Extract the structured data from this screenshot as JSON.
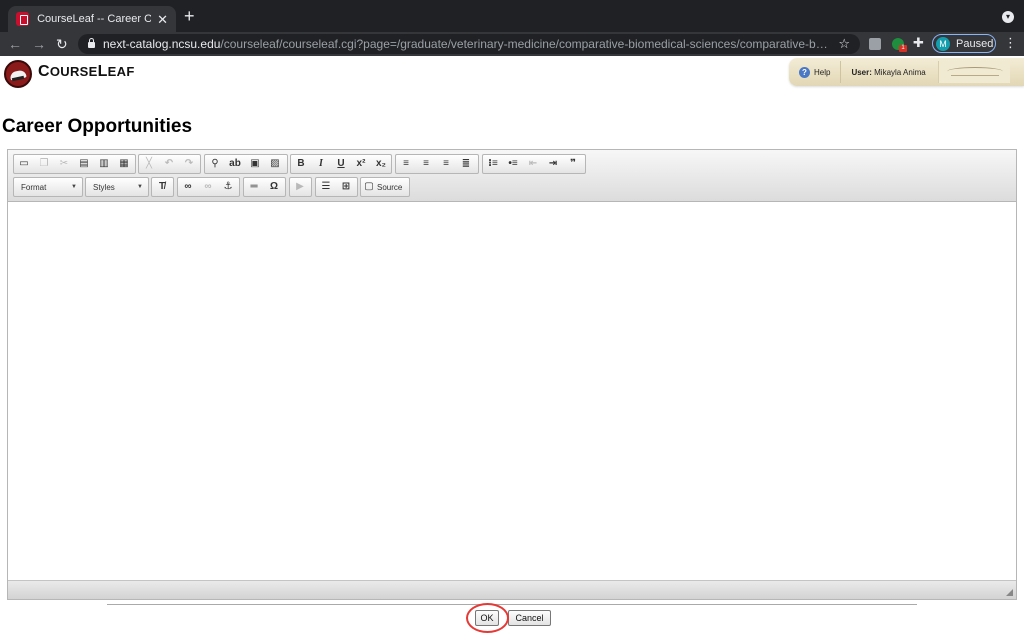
{
  "browser": {
    "tab_title": "CourseLeaf -- Career Opportuni",
    "tab_close": "✕",
    "new_tab": "+",
    "url_host": "next-catalog.ncsu.edu",
    "url_path": "/courseleaf/courseleaf.cgi?page=/graduate/veterinary-medicine/comparative-biomedical-sciences/comparative-biomedical-scienc...",
    "ext_badge": "1",
    "profile_initial": "M",
    "profile_status": "Paused"
  },
  "header": {
    "brand_first": "C",
    "brand_rest": "OURSE",
    "brand_first2": "L",
    "brand_rest2": "EAF",
    "help_label": "Help",
    "user_prefix": "User:",
    "user_name": "Mikayla Anima"
  },
  "page": {
    "title": "Career Opportunities"
  },
  "editor": {
    "format_label": "Format",
    "styles_label": "Styles",
    "source_label": "Source"
  },
  "actions": {
    "ok_label": "OK",
    "cancel_label": "Cancel"
  },
  "colors": {
    "highlight": "#e53935",
    "brand_red": "#8b1a1a"
  }
}
